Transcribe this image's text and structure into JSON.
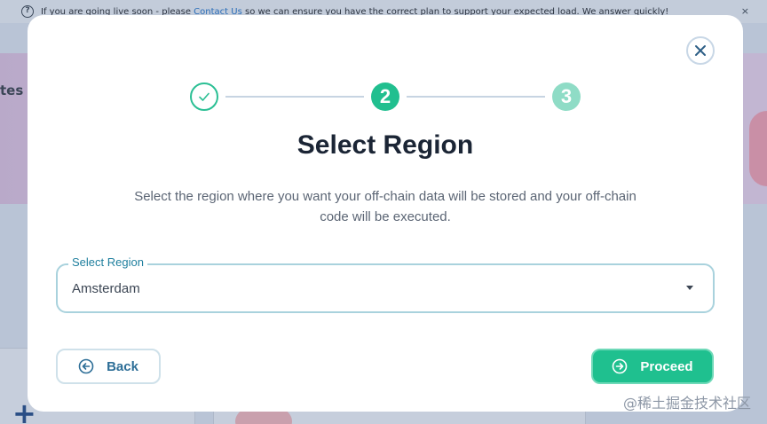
{
  "background": {
    "banner": {
      "text_before": "If you are going live soon - please",
      "link": "Contact Us",
      "text_after": "so we can ensure you have the correct plan to support your expected load. We answer quickly!",
      "info_glyph": "?",
      "close_glyph": "×"
    },
    "title_fragment": "tes",
    "plus_glyph": "+"
  },
  "modal": {
    "close_icon": "close-icon",
    "stepper": [
      {
        "label": "",
        "state": "completed",
        "icon": "check-icon"
      },
      {
        "label": "2",
        "state": "active"
      },
      {
        "label": "3",
        "state": "upcoming"
      }
    ],
    "title": "Select Region",
    "description": "Select the region where you want your off-chain data will be stored and your off-chain code will be executed.",
    "select": {
      "label": "Select Region",
      "value": "Amsterdam"
    },
    "back_label": "Back",
    "proceed_label": "Proceed"
  },
  "watermark": "@稀土掘金技术社区",
  "colors": {
    "accent": "#21bf8f",
    "accent_light": "#8fdcc6",
    "field_border": "#a9d2dd",
    "label_blue": "#1f7f9e"
  }
}
